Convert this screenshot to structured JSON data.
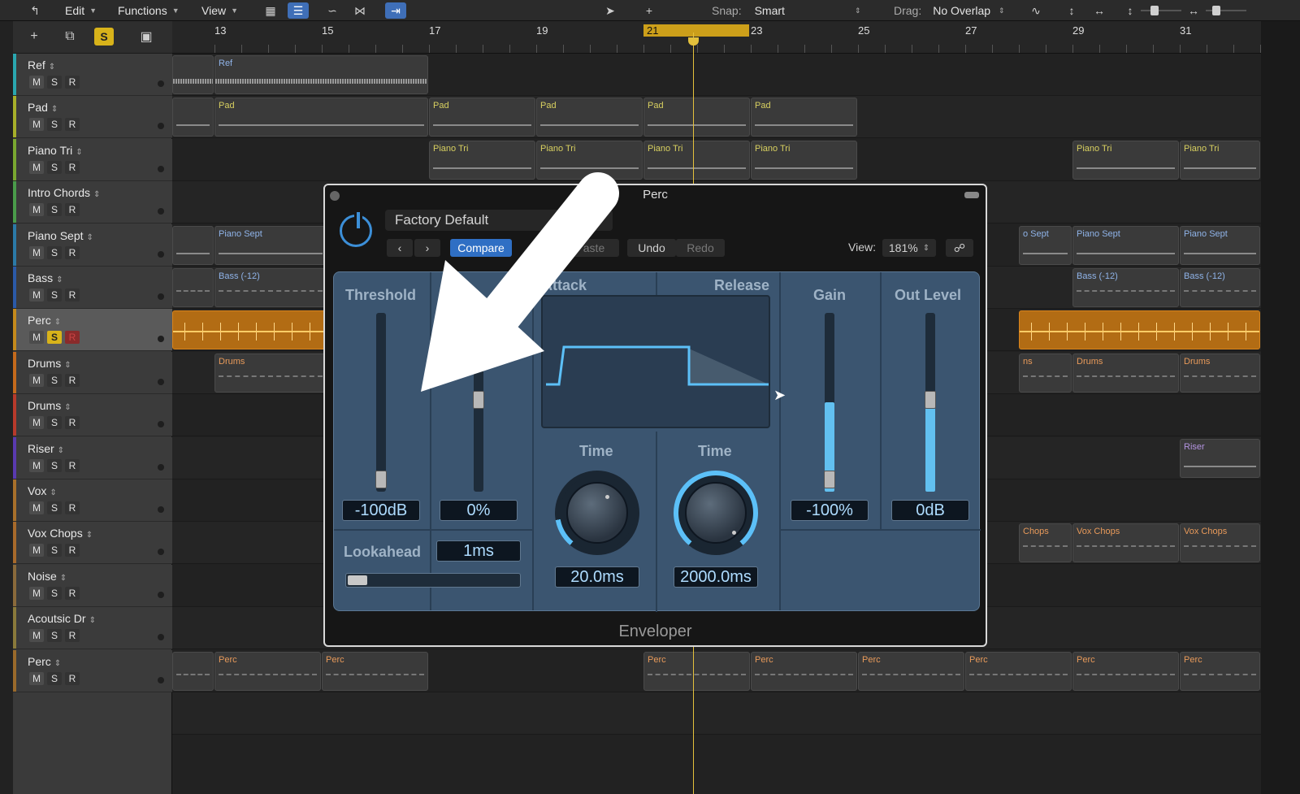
{
  "toolbar": {
    "edit": "Edit",
    "functions": "Functions",
    "view": "View",
    "snap_label": "Snap:",
    "snap_value": "Smart",
    "drag_label": "Drag:",
    "drag_value": "No Overlap"
  },
  "track_header": {
    "add": "+",
    "solo": "S"
  },
  "ruler": {
    "bars": [
      "13",
      "15",
      "17",
      "19",
      "21",
      "23",
      "25",
      "27",
      "29",
      "31"
    ],
    "current_bar": "21"
  },
  "msr": {
    "m": "M",
    "s": "S",
    "r": "R"
  },
  "tracks": [
    {
      "name": "Ref",
      "color": "#2aa7b0"
    },
    {
      "name": "Pad",
      "color": "#a7b02a"
    },
    {
      "name": "Piano Tri",
      "color": "#7aa830"
    },
    {
      "name": "Intro Chords",
      "color": "#4a9c4a"
    },
    {
      "name": "Piano Sept",
      "color": "#2b7aa8"
    },
    {
      "name": "Bass",
      "color": "#2b5aa8"
    },
    {
      "name": "Perc",
      "color": "#c48a1c",
      "selected": true
    },
    {
      "name": "Drums",
      "color": "#c46a1c"
    },
    {
      "name": "Drums",
      "color": "#b83a2b"
    },
    {
      "name": "Riser",
      "color": "#5a3ab0"
    },
    {
      "name": "Vox",
      "color": "#a8702b"
    },
    {
      "name": "Vox Chops",
      "color": "#a86a2b"
    },
    {
      "name": "Noise",
      "color": "#8a6a3b"
    },
    {
      "name": "Acoutsic Dr",
      "color": "#8a7a3b"
    },
    {
      "name": "Perc",
      "color": "#9a6a2b"
    }
  ],
  "regions": {
    "ref": "Ref",
    "pad": "Pad",
    "piano_tri": "Piano Tri",
    "piano_sept": "Piano Sept",
    "piano_sept_partial": "o Sept",
    "bass": "Bass (-12)",
    "drums": "Drums",
    "drums_partial": "ns",
    "riser": "Riser",
    "vox_chops": "Vox Chops",
    "vox_chops_partial": "Chops",
    "perc": "Perc"
  },
  "plugin": {
    "window_title": "Perc",
    "preset": "Factory Default",
    "compare": "Compare",
    "paste": "aste",
    "undo": "Undo",
    "redo": "Redo",
    "view_label": "View:",
    "view_value": "181%",
    "threshold_label": "Threshold",
    "threshold_value": "-100dB",
    "second_value": "0%",
    "attack_label": "Attack",
    "release_label": "Release",
    "time_label": "Time",
    "attack_time": "20.0ms",
    "release_time": "2000.0ms",
    "gain_label": "Gain",
    "gain_value": "-100%",
    "out_level_label": "Out Level",
    "out_level_value": "0dB",
    "lookahead_label": "Lookahead",
    "lookahead_value": "1ms",
    "name": "Enveloper"
  }
}
